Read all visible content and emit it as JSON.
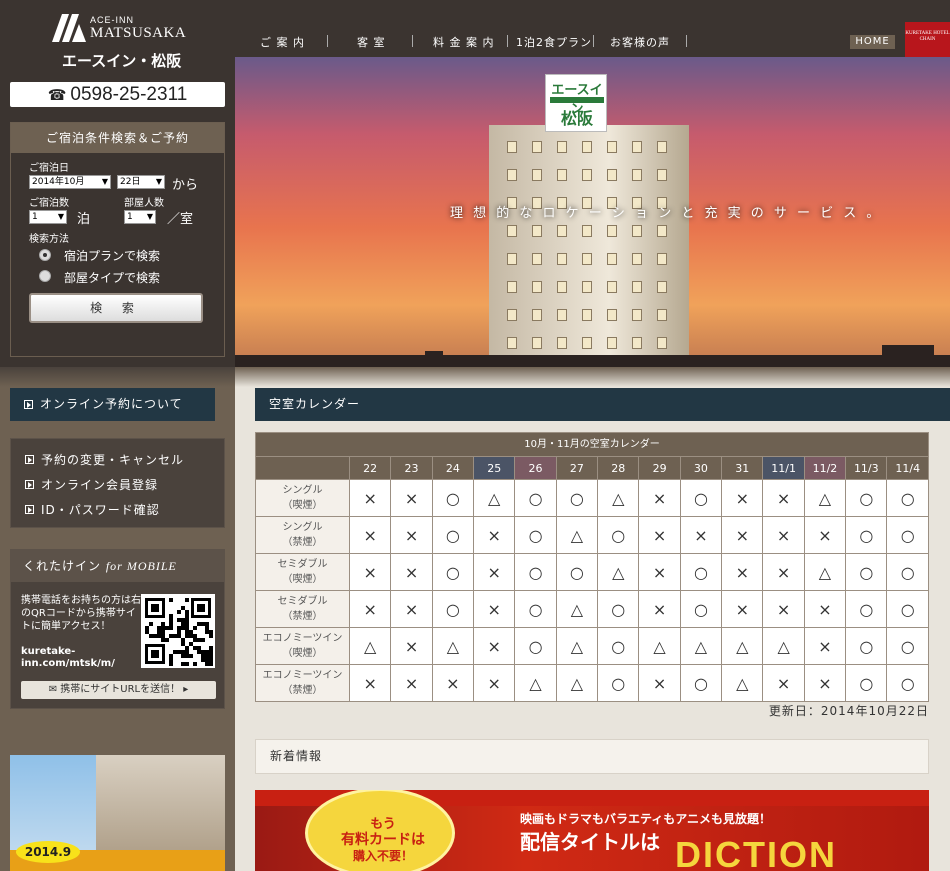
{
  "brand": {
    "sub": "ACE-INN",
    "name": "MATSUSAKA",
    "name_jp": "エースイン・松阪",
    "phone_icon": "☎",
    "phone": "0598-25-2311"
  },
  "nav": {
    "items": [
      "ご 案 内",
      "客 室",
      "料 金 案 内",
      "1泊2食プラン",
      "お客様の声"
    ],
    "home": "HOME",
    "chain_logo": "KURETAKE HOTEL CHAIN"
  },
  "hero": {
    "tagline": "理 想 的 な ロ ケ ー シ ョ ン と 充 実 の サ ー ビ ス 。",
    "sign_top": "エースイン",
    "sign_bottom": "松阪"
  },
  "search": {
    "title": "ご宿泊条件検索＆ご予約",
    "date_label": "ご宿泊日",
    "month_value": "2014年10月",
    "day_value": "22日",
    "from_label": "から",
    "nights_label": "ご宿泊数",
    "nights_value": "1",
    "nights_unit": "泊",
    "people_label": "部屋人数",
    "people_value": "1",
    "people_unit": "／室",
    "method_label": "検索方法",
    "options": [
      "宿泊プランで検索",
      "部屋タイプで検索"
    ],
    "button": "検 索"
  },
  "sidebar": {
    "online_button": "オンライン予約について",
    "links": [
      "予約の変更・キャンセル",
      "オンライン会員登録",
      "ID・パスワード確認"
    ],
    "mobile_title": "くれたけイン",
    "mobile_title_em": "for MOBILE",
    "mobile_text": "携帯電話をお持ちの方は右のQRコードから携帯サイトに簡単アクセス！",
    "mobile_url": "kuretake-inn.com/mtsk/m/",
    "mail_button": "携帯にサイトURLを送信！ ▸",
    "promo_date": "2014.9"
  },
  "calendar": {
    "header": "空室カレンダー",
    "caption": "10月・11月の空室カレンダー",
    "days": [
      "22",
      "23",
      "24",
      "25",
      "26",
      "27",
      "28",
      "29",
      "30",
      "31",
      "11/1",
      "11/2",
      "11/3",
      "11/4"
    ],
    "day_types": [
      "",
      "",
      "",
      "sat",
      "sun",
      "",
      "",
      "",
      "",
      "",
      "sat",
      "sun",
      "",
      ""
    ],
    "rows": [
      {
        "type": "シングル",
        "smoke": "（喫煙）",
        "status": [
          "×",
          "×",
          "○",
          "△",
          "○",
          "○",
          "△",
          "×",
          "○",
          "×",
          "×",
          "△",
          "○",
          "○"
        ]
      },
      {
        "type": "シングル",
        "smoke": "（禁煙）",
        "status": [
          "×",
          "×",
          "○",
          "×",
          "○",
          "△",
          "○",
          "×",
          "×",
          "×",
          "×",
          "×",
          "○",
          "○"
        ]
      },
      {
        "type": "セミダブル",
        "smoke": "（喫煙）",
        "status": [
          "×",
          "×",
          "○",
          "×",
          "○",
          "○",
          "△",
          "×",
          "○",
          "×",
          "×",
          "△",
          "○",
          "○"
        ]
      },
      {
        "type": "セミダブル",
        "smoke": "（禁煙）",
        "status": [
          "×",
          "×",
          "○",
          "×",
          "○",
          "△",
          "○",
          "×",
          "○",
          "×",
          "×",
          "×",
          "○",
          "○"
        ]
      },
      {
        "type": "エコノミーツイン",
        "smoke": "（喫煙）",
        "status": [
          "△",
          "×",
          "△",
          "×",
          "○",
          "△",
          "○",
          "△",
          "△",
          "△",
          "△",
          "×",
          "○",
          "○"
        ]
      },
      {
        "type": "エコノミーツイン",
        "smoke": "（禁煙）",
        "status": [
          "×",
          "×",
          "×",
          "×",
          "△",
          "△",
          "○",
          "×",
          "○",
          "△",
          "×",
          "×",
          "○",
          "○"
        ]
      }
    ],
    "updated": "更新日：2014年10月22日"
  },
  "news": {
    "header": "新着情報"
  },
  "banner": {
    "badge_1": "もう",
    "badge_2": "有料カードは",
    "badge_3": "購入不要！",
    "line_1": "映画もドラマもバラエティもアニメも見放題！",
    "line_2": "配信タイトルは",
    "line_3": "DICTION"
  },
  "colors": {
    "dark_brown": "#3b3430",
    "brown": "#6e6152",
    "navy": "#223744",
    "saturday": "#4b5466",
    "sunday": "#7b5a63",
    "chain_red": "#b8161c"
  }
}
